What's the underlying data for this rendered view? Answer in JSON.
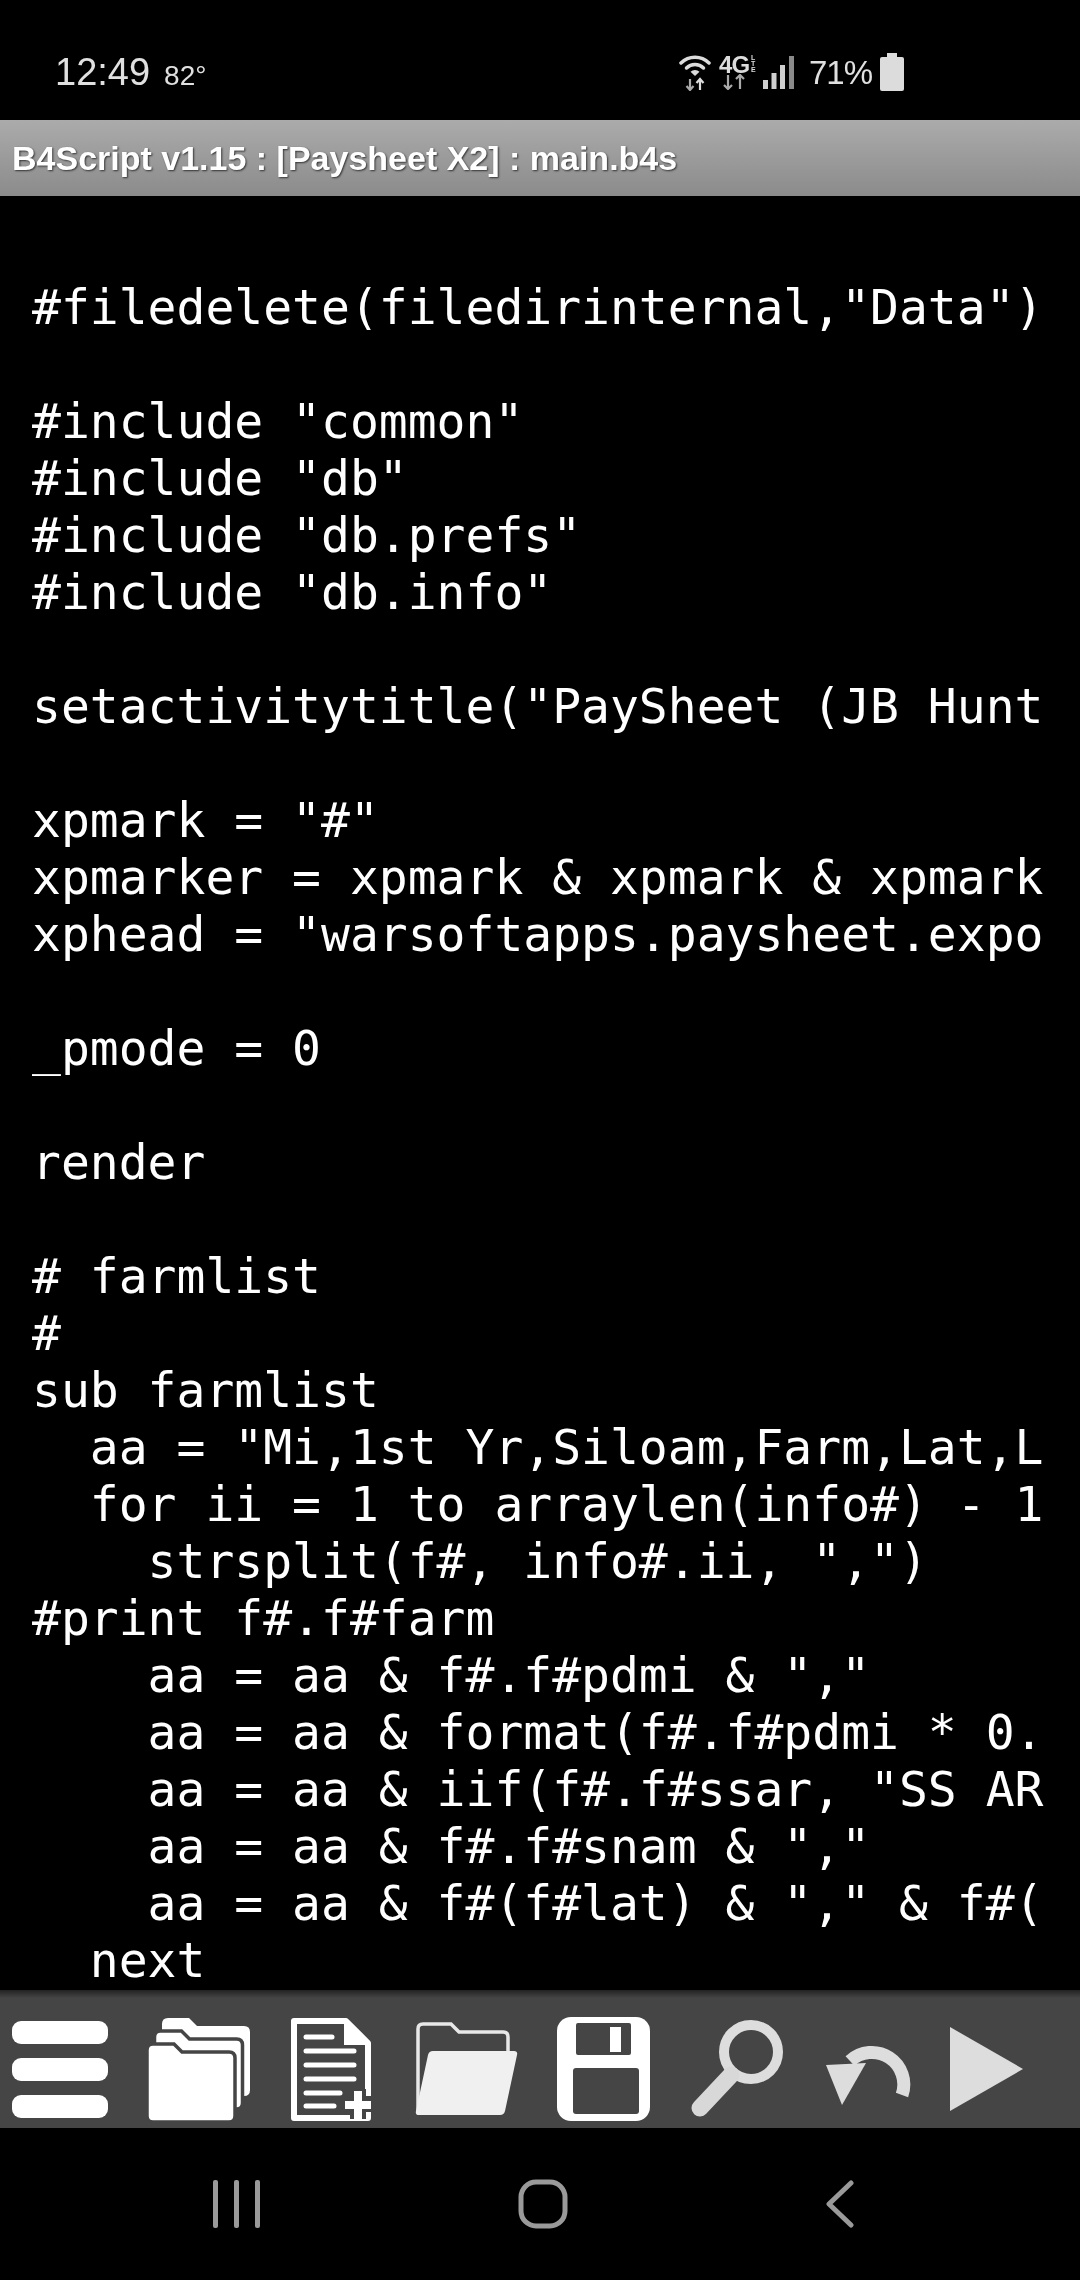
{
  "status_bar": {
    "time": "12:49",
    "temperature": "82°",
    "network_type": "4G",
    "network_subtype": "LTE",
    "battery": "71%"
  },
  "title_bar": {
    "title": "B4Script v1.15 : [Paysheet X2] : main.b4s"
  },
  "editor": {
    "blocks": [
      [
        "#filedelete(filedirinternal,\"Data\")"
      ],
      [
        "#include \"common\"",
        "#include \"db\"",
        "#include \"db.prefs\"",
        "#include \"db.info\""
      ],
      [
        "setactivitytitle(\"PaySheet (JB Hunt"
      ],
      [
        "xpmark = \"#\"",
        "xpmarker = xpmark & xpmark & xpmark",
        "xphead = \"warsoftapps.paysheet.expo"
      ],
      [
        "_pmode = 0"
      ],
      [
        "render"
      ],
      [
        "# farmlist",
        "#",
        "sub farmlist",
        "  aa = \"Mi,1st Yr,Siloam,Farm,Lat,L",
        "  for ii = 1 to arraylen(info#) - 1",
        "    strsplit(f#, info#.ii, \",\")",
        "#print f#.f#farm",
        "    aa = aa & f#.f#pdmi & \",\"",
        "    aa = aa & format(f#.f#pdmi * 0.",
        "    aa = aa & iif(f#.f#ssar, \"SS AR",
        "    aa = aa & f#.f#snam & \",\"",
        "    aa = aa & f#(f#lat) & \",\" & f#(",
        "  next"
      ]
    ]
  }
}
